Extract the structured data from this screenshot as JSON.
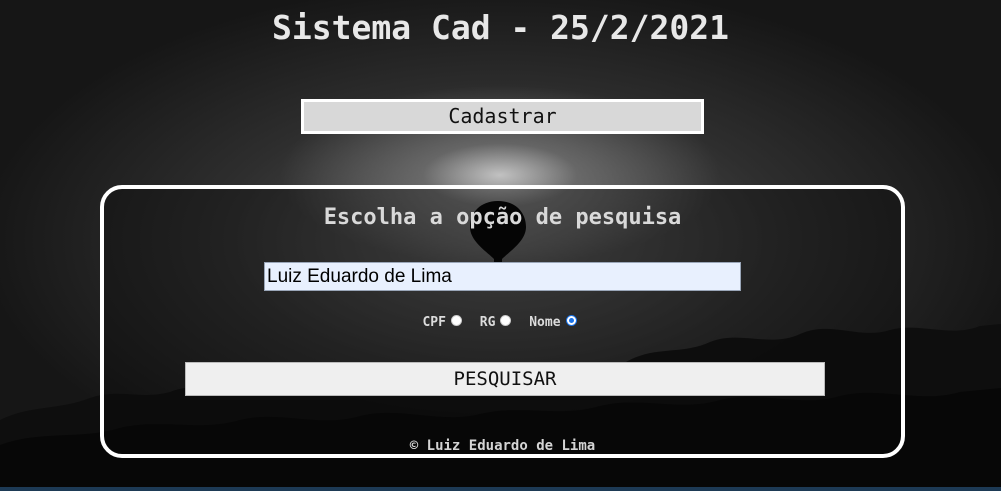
{
  "page": {
    "title": "Sistema Cad - 25/2/2021"
  },
  "header": {
    "register_button_label": "Cadastrar"
  },
  "search_panel": {
    "heading": "Escolha a opção de pesquisa",
    "search_input": {
      "value": "Luiz Eduardo de Lima",
      "placeholder": ""
    },
    "options": [
      {
        "label": "CPF",
        "checked": false
      },
      {
        "label": "RG",
        "checked": false
      },
      {
        "label": "Nome",
        "checked": true
      }
    ],
    "search_button_label": "PESQUISAR",
    "footer": "© Luiz Eduardo de Lima"
  },
  "icons": {
    "balloon": "hot-air-balloon-icon",
    "radio": "radio-button"
  },
  "colors": {
    "panel_border": "#ffffff",
    "input_background": "#e8f0fe",
    "radio_selected": "#1a73e8"
  }
}
